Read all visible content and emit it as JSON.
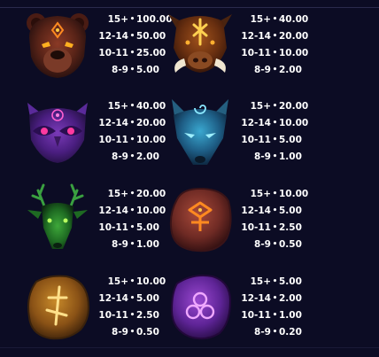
{
  "symbols": [
    {
      "name": "bear",
      "pays": [
        {
          "count": "15+",
          "value": "100.00"
        },
        {
          "count": "12-14",
          "value": "50.00"
        },
        {
          "count": "10-11",
          "value": "25.00"
        },
        {
          "count": "8-9",
          "value": "5.00"
        }
      ]
    },
    {
      "name": "boar",
      "pays": [
        {
          "count": "15+",
          "value": "40.00"
        },
        {
          "count": "12-14",
          "value": "20.00"
        },
        {
          "count": "10-11",
          "value": "10.00"
        },
        {
          "count": "8-9",
          "value": "2.00"
        }
      ]
    },
    {
      "name": "owl",
      "pays": [
        {
          "count": "15+",
          "value": "40.00"
        },
        {
          "count": "12-14",
          "value": "20.00"
        },
        {
          "count": "10-11",
          "value": "10.00"
        },
        {
          "count": "8-9",
          "value": "2.00"
        }
      ]
    },
    {
      "name": "wolf",
      "pays": [
        {
          "count": "15+",
          "value": "20.00"
        },
        {
          "count": "12-14",
          "value": "10.00"
        },
        {
          "count": "10-11",
          "value": "5.00"
        },
        {
          "count": "8-9",
          "value": "1.00"
        }
      ]
    },
    {
      "name": "stag",
      "pays": [
        {
          "count": "15+",
          "value": "20.00"
        },
        {
          "count": "12-14",
          "value": "10.00"
        },
        {
          "count": "10-11",
          "value": "5.00"
        },
        {
          "count": "8-9",
          "value": "1.00"
        }
      ]
    },
    {
      "name": "red rune stone",
      "pays": [
        {
          "count": "15+",
          "value": "10.00"
        },
        {
          "count": "12-14",
          "value": "5.00"
        },
        {
          "count": "10-11",
          "value": "2.50"
        },
        {
          "count": "8-9",
          "value": "0.50"
        }
      ]
    },
    {
      "name": "gold rune stone",
      "pays": [
        {
          "count": "15+",
          "value": "10.00"
        },
        {
          "count": "12-14",
          "value": "5.00"
        },
        {
          "count": "10-11",
          "value": "2.50"
        },
        {
          "count": "8-9",
          "value": "0.50"
        }
      ]
    },
    {
      "name": "purple rune stone",
      "pays": [
        {
          "count": "15+",
          "value": "5.00"
        },
        {
          "count": "12-14",
          "value": "2.00"
        },
        {
          "count": "10-11",
          "value": "1.00"
        },
        {
          "count": "8-9",
          "value": "0.20"
        }
      ]
    }
  ],
  "separator": "•"
}
